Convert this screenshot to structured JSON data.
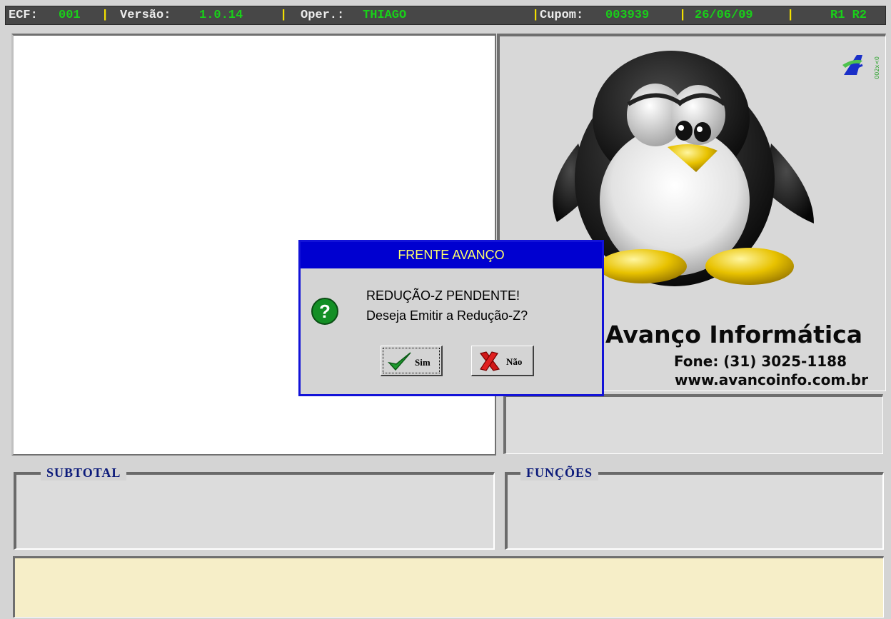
{
  "status_bar": {
    "ecf_label": "ECF:",
    "ecf_value": "001",
    "version_label": "Versão:",
    "version_value": "1.0.14",
    "operator_label": "Oper.:",
    "operator_value": "THIAGO",
    "coupon_label": "Cupom:",
    "coupon_value": "003939",
    "date_value": "26/06/09",
    "status_value": "R1 R2",
    "separator": "|"
  },
  "logo": {
    "company_name": "Avanço Informática",
    "phone": "Fone: (31) 3025-1188",
    "website": "www.avancoinfo.com.br",
    "badge_text": "002x<0"
  },
  "groups": {
    "subtotal_label": "SUBTOTAL",
    "functions_label": "FUNÇÕES"
  },
  "dialog": {
    "title": "FRENTE AVANÇO",
    "message_line1": "REDUÇÃO-Z PENDENTE!",
    "message_line2": "Deseja Emitir a Redução-Z?",
    "yes_label": "Sim",
    "no_label": "Não"
  },
  "colors": {
    "status_bar_bg": "#474747",
    "status_value": "#19d019",
    "separator": "#f3e000",
    "dialog_title_bg": "#0000d0",
    "dialog_title_text": "#ffff6a",
    "group_label": "#0b1a7a",
    "message_bar_bg": "#f6eec8"
  },
  "icons": {
    "dialog_icon": "question-icon",
    "yes_icon": "checkmark-icon",
    "no_icon": "red-x-icon",
    "mascot": "penguin-mascot",
    "brand": "avanco-logo-icon"
  }
}
